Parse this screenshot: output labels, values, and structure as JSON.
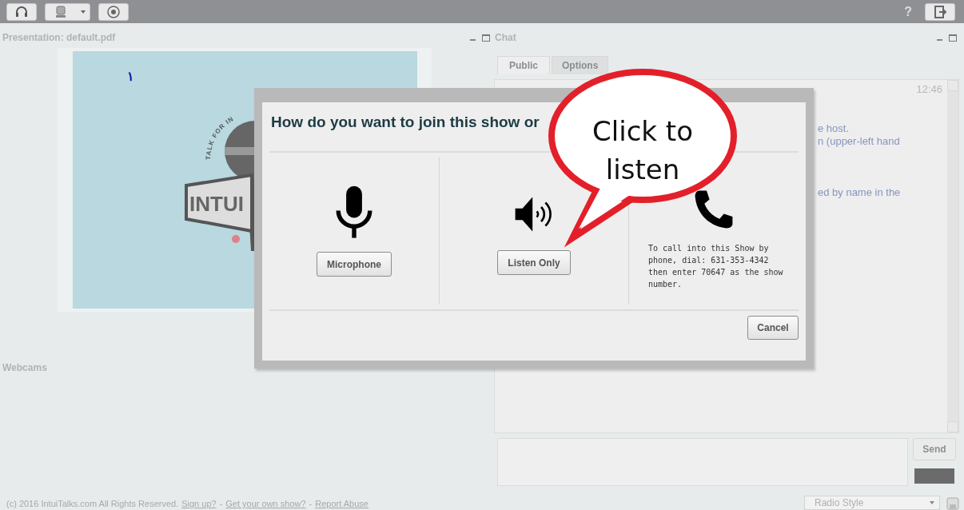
{
  "toolbar": {
    "buttons": [
      {
        "kind": "headset",
        "dropdown": false
      },
      {
        "kind": "webcam",
        "dropdown": true
      },
      {
        "kind": "record",
        "dropdown": false
      }
    ],
    "help": "?"
  },
  "presentation": {
    "title": "Presentation: default.pdf",
    "slide": {
      "page_mark": "١",
      "logo_text": "INTUI",
      "logo_arc": "TALK FOR IN"
    }
  },
  "webcams": {
    "title": "Webcams"
  },
  "chat": {
    "title": "Chat",
    "tabs": [
      {
        "label": "Public",
        "selected": true
      },
      {
        "label": "Options",
        "selected": false
      }
    ],
    "time": "12:46",
    "messages": [
      {
        "lines": [
          "e host.",
          "n (upper-left hand"
        ]
      },
      {
        "lines": [
          "ed by name in the"
        ]
      }
    ],
    "send": "Send"
  },
  "footer": {
    "copyright": "(c) 2016 IntuiTalks.com All Rights Reserved.",
    "separator": "-",
    "links": [
      "Sign up?",
      "Get your own show?",
      "Report Abuse"
    ],
    "layout": "Radio Style"
  },
  "dialog": {
    "title": "How do you want to join this show or",
    "options": [
      {
        "kind": "microphone",
        "button": "Microphone"
      },
      {
        "kind": "listen",
        "button": "Listen Only"
      },
      {
        "kind": "phone",
        "note": "To call into this Show by phone, dial: 631-353-4342 then enter 70647 as the show number."
      }
    ],
    "cancel": "Cancel"
  },
  "callout": {
    "text": "Click to listen"
  }
}
